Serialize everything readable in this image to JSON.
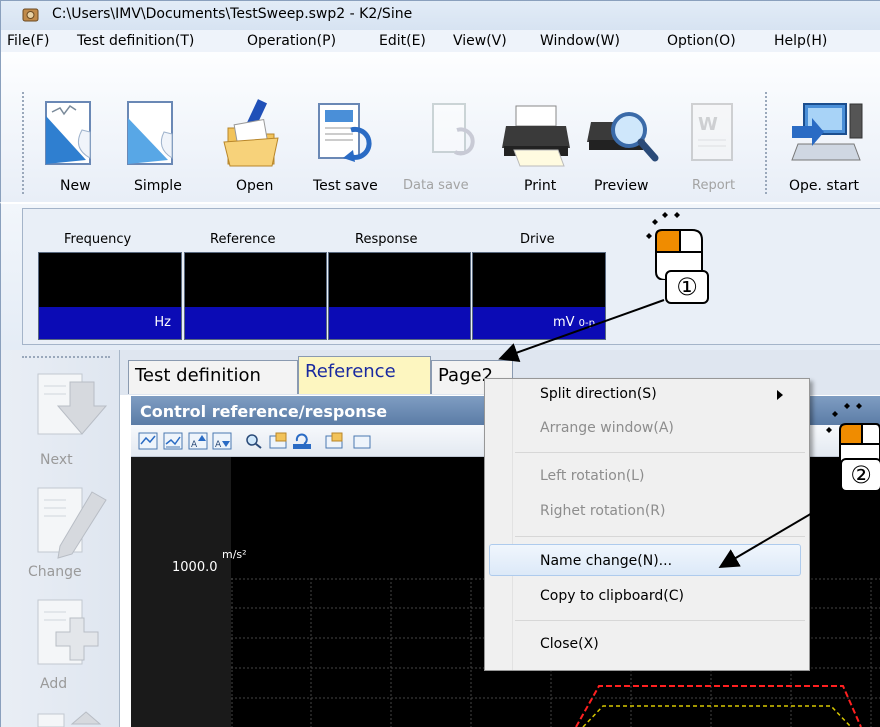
{
  "window": {
    "title": "C:\\Users\\IMV\\Documents\\TestSweep.swp2 - K2/Sine"
  },
  "menubar": {
    "items": [
      "File(F)",
      "Test definition(T)",
      "Operation(P)",
      "Edit(E)",
      "View(V)",
      "Window(W)",
      "Option(O)",
      "Help(H)"
    ]
  },
  "toolbar": {
    "new": "New",
    "simple": "Simple",
    "open": "Open",
    "test_save": "Test save",
    "data_save": "Data save",
    "print": "Print",
    "preview": "Preview",
    "report": "Report",
    "ope_start": "Ope. start"
  },
  "monitor": {
    "frequency_label": "Frequency",
    "reference_label": "Reference",
    "response_label": "Response",
    "drive_label": "Drive",
    "frequency_unit": "Hz",
    "drive_unit": "mV",
    "drive_unit_sub": "0-p"
  },
  "sidepanel": {
    "next": "Next",
    "change": "Change",
    "add": "Add"
  },
  "tabs": {
    "test_definition": "Test definition",
    "reference": "Reference",
    "page": "Page2"
  },
  "inner_window": {
    "title": "Control reference/response"
  },
  "chart": {
    "y_top": "1000.0",
    "y_unit": "m/s²"
  },
  "context_menu": {
    "split_direction": "Split direction(S)",
    "arrange_window": "Arrange window(A)",
    "left_rotation": "Left rotation(L)",
    "righet_rotation": "Righet rotation(R)",
    "name_change": "Name change(N)...",
    "copy_clipboard": "Copy to clipboard(C)",
    "close": "Close(X)"
  },
  "callouts": {
    "step1": "①",
    "step2": "②"
  },
  "colors": {
    "monitor_unit_bg": "#0b0bb5",
    "reference_tab_bg": "#fdf6c0",
    "inner_title_bg": "#5b7ca6",
    "mouse_button": "#f08c00"
  }
}
